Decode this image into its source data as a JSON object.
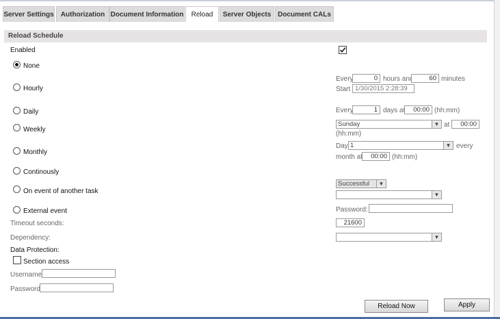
{
  "tabs": [
    "Server Settings",
    "Authorization",
    "Document Information",
    "Reload",
    "Server Objects",
    "Document CALs"
  ],
  "section_title": "Reload Schedule",
  "enabled": {
    "label": "Enabled",
    "checked": true
  },
  "options": {
    "none": "None",
    "hourly": "Hourly",
    "daily": "Daily",
    "weekly": "Weekly",
    "monthly": "Monthly",
    "continously": "Continously",
    "on_event": "On event of another task",
    "external": "External event"
  },
  "selected_option": "None",
  "hourly": {
    "every_label": "Every",
    "hours_value": "0",
    "hours_and_label": "hours and",
    "minutes_value": "60",
    "minutes_label": "minutes",
    "start_label": "Start",
    "start_value": "1/30/2015 2:28:39 PM"
  },
  "daily": {
    "every_label": "Every",
    "days_value": "1",
    "days_at_label": "days at",
    "time_value": "00:00",
    "format_label": "(hh:mm)"
  },
  "weekly": {
    "day_value": "Sunday",
    "at_label": "at",
    "time_value": "00:00",
    "format_label": "(hh:mm)"
  },
  "monthly": {
    "day_label": "Day",
    "day_value": "1",
    "every_label": "every",
    "month_at_label": "month at",
    "time_value": "00:00",
    "format_label": "(hh:mm)"
  },
  "on_event": {
    "status_value": "Successful",
    "task_value": ""
  },
  "external": {
    "password_label": "Password:",
    "password_value": ""
  },
  "timeout": {
    "label": "Timeout seconds:",
    "value": "21600"
  },
  "dependency": {
    "label": "Dependency:",
    "value": ""
  },
  "data_protection": {
    "label": "Data Protection:",
    "section_access": "Section access",
    "section_access_checked": false,
    "username_label": "Username:",
    "username_value": "",
    "password_label": "Password:",
    "password_value": ""
  },
  "buttons": {
    "reload_now": "Reload Now",
    "apply": "Apply"
  }
}
